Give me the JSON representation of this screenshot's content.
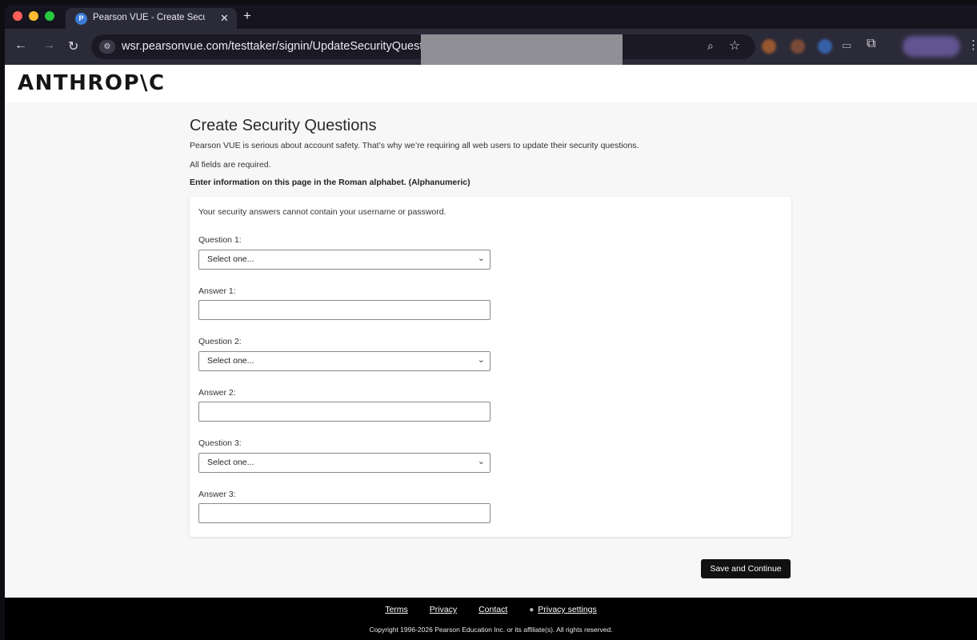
{
  "browser": {
    "tab": {
      "title": "Pearson VUE - Create Securit",
      "favicon": "P"
    },
    "url": "wsr.pearsonvue.com/testtaker/signin/UpdateSecurityQuestions",
    "icons": {
      "back": "←",
      "forward": "→",
      "reload": "↻",
      "site_info": "⚙",
      "zoom": "⌕",
      "bookmark": "☆",
      "cast": "▭",
      "extensions": "⧉",
      "menu": "⋮",
      "close": "✕",
      "new_tab": "+"
    }
  },
  "brand": {
    "logo": "ANTHROP\\C"
  },
  "main": {
    "title": "Create Security Questions",
    "intro": "Pearson VUE is serious about account safety. That’s why we’re requiring all web users to update their security questions.",
    "required_note": "All fields are required.",
    "alphabet_note": "Enter information on this page in the Roman alphabet. (Alphanumeric)"
  },
  "form": {
    "note": "Your security answers cannot contain your username or password.",
    "question1_label": "Question 1:",
    "question1_value": "Select one...",
    "answer1_label": "Answer 1:",
    "question2_label": "Question 2:",
    "question2_value": "Select one...",
    "answer2_label": "Answer 2:",
    "question3_label": "Question 3:",
    "question3_value": "Select one...",
    "answer3_label": "Answer 3:",
    "chevron": "⌄",
    "submit_label": "Save and Continue"
  },
  "footer": {
    "links": [
      "Terms",
      "Privacy",
      "Contact"
    ],
    "privacy_settings": "Privacy settings",
    "copyright": "Copyright 1996-2026 Pearson Education Inc. or its affiliate(s). All rights reserved."
  }
}
